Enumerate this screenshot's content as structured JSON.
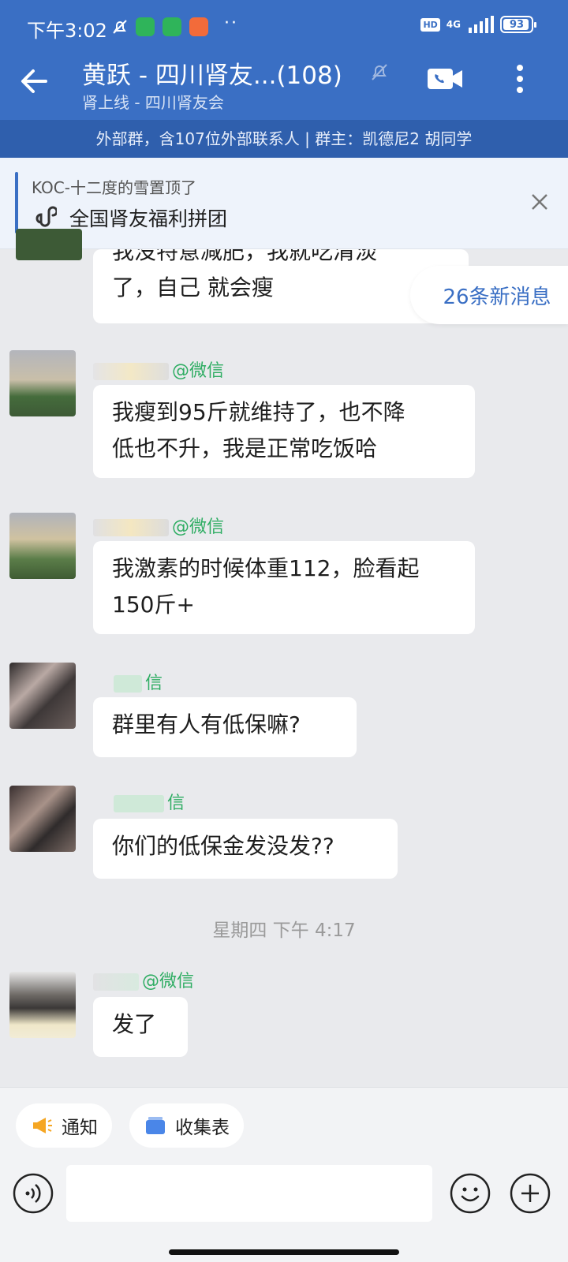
{
  "status_bar": {
    "time": "下午3:02",
    "more": "··",
    "hd": "HD",
    "network": "4G",
    "battery": "93"
  },
  "header": {
    "title": "黄跃 - 四川肾友...(108)",
    "subtitle": "肾上线 - 四川肾友会",
    "info": "外部群，含107位外部联系人 | 群主：凯德尼2 胡同学"
  },
  "pinned": {
    "from": "KOC-十二度的雪置顶了",
    "text": "全国肾友福利拼团"
  },
  "new_messages": "26条新消息",
  "messages": [
    {
      "sender_suffix": "",
      "lines": [
        "我没特意减肥，我就吃清淡",
        "了，自己 就会瘦"
      ]
    },
    {
      "sender_suffix": "@微信",
      "lines": [
        "我瘦到95斤就维持了，也不降",
        "低也不升，我是正常吃饭哈"
      ]
    },
    {
      "sender_suffix": "@微信",
      "lines": [
        "我激素的时候体重112，脸看起",
        "150斤+"
      ]
    },
    {
      "sender_suffix": "信",
      "lines": [
        "群里有人有低保嘛?"
      ]
    },
    {
      "sender_suffix": "信",
      "lines": [
        "你们的低保金发没发??"
      ]
    },
    {
      "sender_suffix": "@微信",
      "lines": [
        "发了"
      ]
    }
  ],
  "time_divider": "星期四  下午 4:17",
  "quick_actions": [
    {
      "label": "通知",
      "icon": "megaphone-icon"
    },
    {
      "label": "收集表",
      "icon": "form-icon"
    }
  ],
  "input": {
    "value": ""
  },
  "colors": {
    "header": "#3a6fc4",
    "info_bar": "#2f5fad",
    "sender": "#2fad63",
    "background": "#e9eaed"
  }
}
